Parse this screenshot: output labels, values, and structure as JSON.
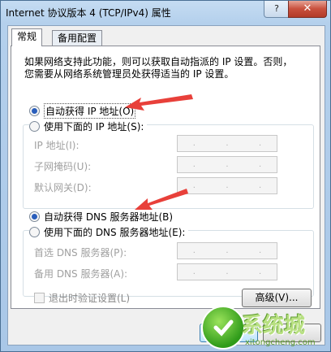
{
  "window": {
    "title": "Internet 协议版本 4 (TCP/IPv4) 属性",
    "help_label": "?",
    "close_label": "✕"
  },
  "tabs": [
    {
      "label": "常规"
    },
    {
      "label": "备用配置"
    }
  ],
  "description": {
    "line1": "如果网络支持此功能，则可以获取自动指派的 IP 设置。否则，",
    "line2": "您需要从网络系统管理员处获得适当的 IP 设置。"
  },
  "ip_section": {
    "auto_label": "自动获得 IP 地址(O)",
    "manual_label": "使用下面的 IP 地址(S):",
    "fields": [
      {
        "label": "IP 地址(I):"
      },
      {
        "label": "子网掩码(U):"
      },
      {
        "label": "默认网关(D):"
      }
    ]
  },
  "dns_section": {
    "auto_label": "自动获得 DNS 服务器地址(B)",
    "manual_label": "使用下面的 DNS 服务器地址(E):",
    "fields": [
      {
        "label": "首选 DNS 服务器(P):"
      },
      {
        "label": "备用 DNS 服务器(A):"
      }
    ]
  },
  "validate_checkbox_label": "退出时验证设置(L)",
  "advanced_button_label": "高级(V)...",
  "watermark": {
    "brand": "系统城",
    "url": "xitongcheng.com"
  },
  "colors": {
    "accent": "#2a5ebb",
    "arrow": "#e8403a"
  },
  "icons": {
    "close": "close-icon",
    "help": "help-icon",
    "arrow": "red-arrow-annotation"
  }
}
